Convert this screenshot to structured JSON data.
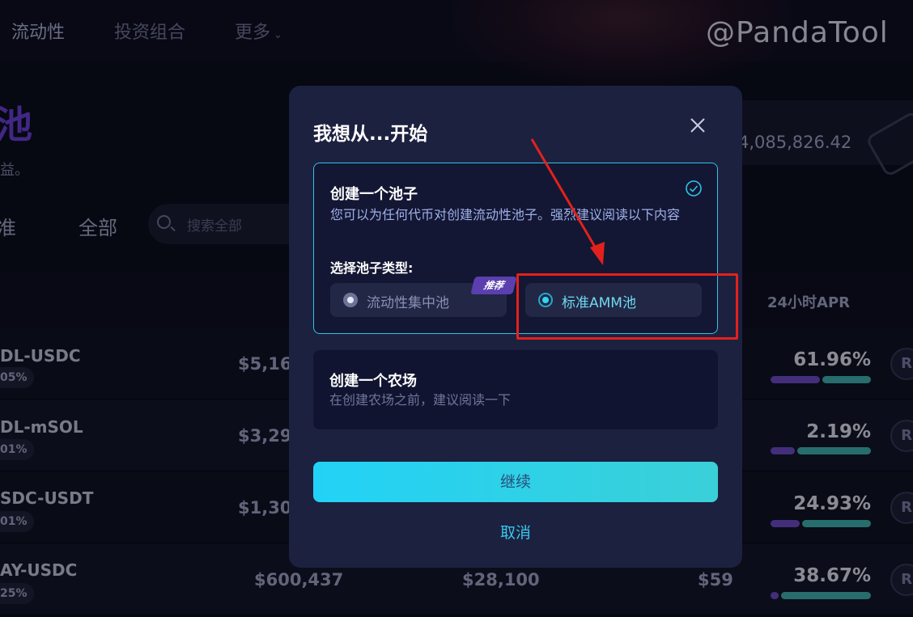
{
  "nav": {
    "items": [
      "流动性",
      "投资组合",
      "更多"
    ],
    "active_index": 0
  },
  "watermark": "@PandaTool",
  "background": {
    "title_fragment": "池",
    "subtitle_fragment": "益。",
    "tvl_fragment": "4,085,826.42",
    "tabs": [
      "准",
      "全部"
    ],
    "search_placeholder": "搜索全部",
    "apr_header": "24小时APR",
    "rows": [
      {
        "pair": "DL-USDC",
        "fee": "05%",
        "liquidity": "$5,16",
        "apr": "61.96%",
        "bar_purple": 0.5,
        "bar_teal": 0.5
      },
      {
        "pair": "DL-mSOL",
        "fee": "01%",
        "liquidity": "$3,29",
        "apr": "2.19%",
        "bar_purple": 0.25,
        "bar_teal": 0.75
      },
      {
        "pair": "SDC-USDT",
        "fee": "01%",
        "liquidity": "$1,30",
        "apr": "24.93%",
        "bar_purple": 0.3,
        "bar_teal": 0.7
      },
      {
        "pair": "AY-USDC",
        "fee": "25%",
        "liquidity": "$600,437",
        "volume": "$28,100",
        "fees": "$59",
        "apr": "38.67%",
        "bar_purple": 0.08,
        "bar_teal": 0.92
      }
    ]
  },
  "modal": {
    "title": "我想从...开始",
    "pool_card": {
      "title": "创建一个池子",
      "desc": "您可以为任何代币对创建流动性池子。强烈建议阅读以下内容",
      "type_label": "选择池子类型:",
      "options": [
        {
          "label": "流动性集中池",
          "selected": false,
          "badge": "推荐"
        },
        {
          "label": "标准AMM池",
          "selected": true
        }
      ]
    },
    "farm_card": {
      "title": "创建一个农场",
      "desc": "在创建农场之前，建议阅读一下"
    },
    "continue_label": "继续",
    "cancel_label": "取消"
  },
  "colors": {
    "accent_cyan": "#22d2f6",
    "annotation_red": "#e3211c",
    "modal_bg": "#1c2140"
  }
}
